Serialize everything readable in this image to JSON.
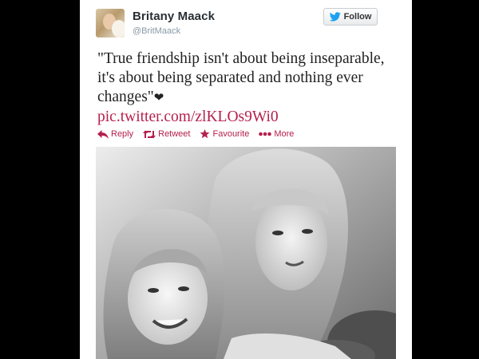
{
  "user": {
    "display_name": "Britany Maack",
    "handle": "@BritMaack"
  },
  "follow_button": {
    "label": "Follow",
    "icon": "twitter-bird-icon",
    "icon_color": "#1da1f2"
  },
  "tweet": {
    "text": "\"True friendship isn't about being inseparable, it's about being separated and nothing ever changes\"",
    "heart_glyph": "❤",
    "link": "pic.twitter.com/zlKLOs9Wi0"
  },
  "actions": [
    {
      "label": "Reply",
      "icon": "reply-arrow-icon"
    },
    {
      "label": "Retweet",
      "icon": "retweet-icon"
    },
    {
      "label": "Favourite",
      "icon": "star-icon"
    },
    {
      "label": "More",
      "icon": "more-dots-icon"
    }
  ],
  "colors": {
    "accent": "#b5204e",
    "background": "#000000",
    "card": "#ffffff"
  },
  "photo": {
    "icon": "photo-black-and-white",
    "style": "black-and-white portrait of two women"
  }
}
